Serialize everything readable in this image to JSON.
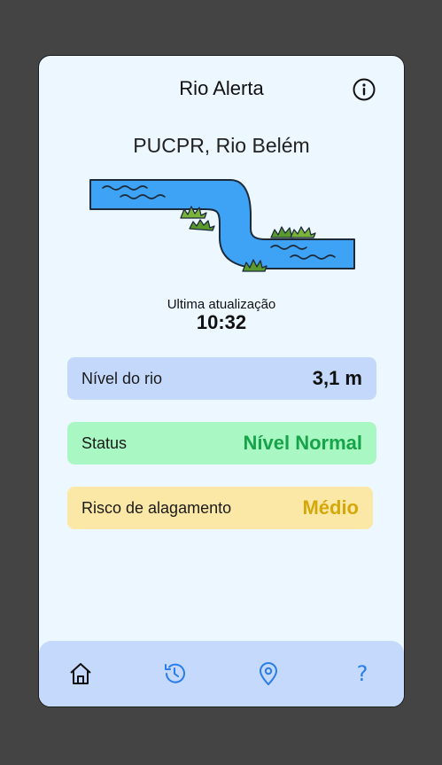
{
  "header": {
    "title": "Rio Alerta",
    "info_icon": "info-icon"
  },
  "location": "PUCPR, Rio Belém",
  "last_update": {
    "label": "Ultima atualização",
    "time": "10:32"
  },
  "cards": {
    "level": {
      "label": "Nível do rio",
      "value": "3,1 m"
    },
    "status": {
      "label": "Status",
      "value": "Nível Normal",
      "color": "#16a34a"
    },
    "risk": {
      "label": "Risco de alagamento",
      "value": "Médio",
      "color": "#d4a80a"
    }
  },
  "nav": {
    "items": [
      {
        "icon": "home-icon"
      },
      {
        "icon": "history-icon"
      },
      {
        "icon": "location-pin-icon"
      },
      {
        "icon": "help-icon",
        "glyph": "?"
      }
    ],
    "active_color": "#111111",
    "inactive_color": "#2b7de9"
  },
  "colors": {
    "background": "#444444",
    "screen": "#edf7ff",
    "river": "#3ea2f5"
  }
}
